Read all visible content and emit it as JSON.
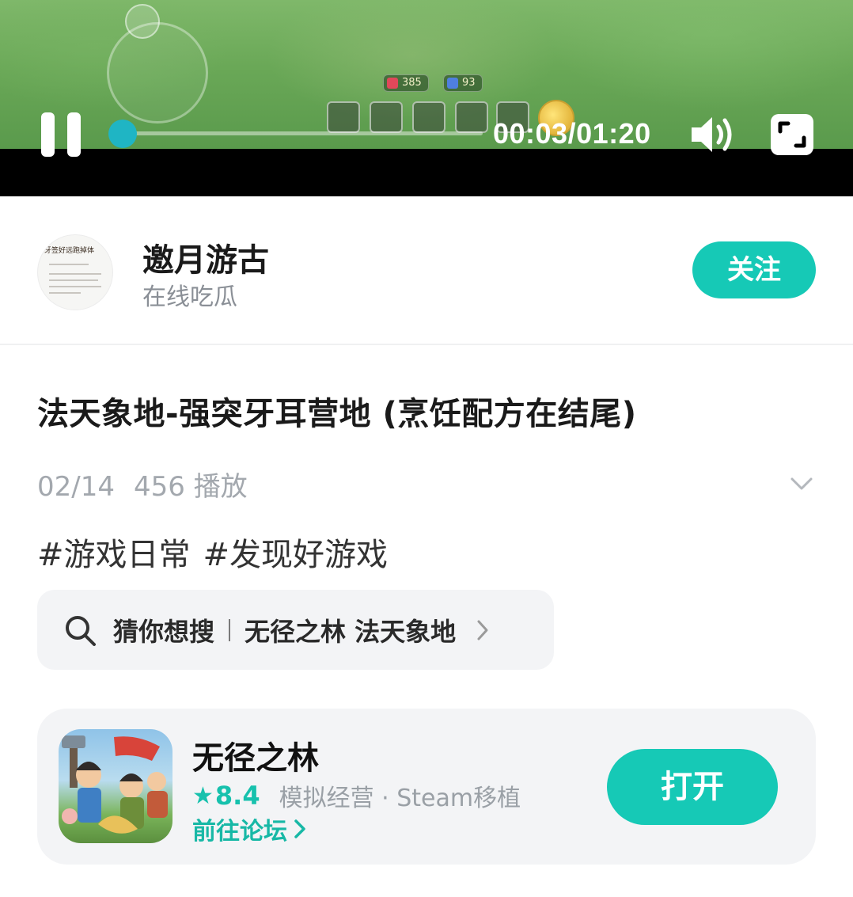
{
  "player": {
    "time": "00:03/01:20",
    "progress": 0.04,
    "hud": {
      "stat_a": "385",
      "stat_b": "93"
    },
    "pause_icon": "pause-icon",
    "volume_icon": "volume-icon",
    "fullscreen_icon": "fullscreen-icon"
  },
  "author": {
    "name": "邀月游古",
    "subtitle": "在线吃瓜",
    "follow_label": "关注",
    "avatar_caption": "牙签好远跑掉体"
  },
  "post": {
    "title": "法天象地-强突牙耳营地 (烹饪配方在结尾)",
    "date": "02/14",
    "plays": "456 播放",
    "tags": [
      "#游戏日常",
      "#发现好游戏"
    ]
  },
  "search_suggest": {
    "label": "猜你想搜",
    "keywords": "无径之林 法天象地"
  },
  "game": {
    "name": "无径之林",
    "score": "8.4",
    "genre": "模拟经营 · Steam移植",
    "forum_label": "前往论坛",
    "open_label": "打开"
  },
  "colors": {
    "accent": "#16c9b6",
    "progress_handle": "#1fb5c4",
    "muted_text": "#a3a8ae",
    "card_bg": "#f3f4f6"
  }
}
